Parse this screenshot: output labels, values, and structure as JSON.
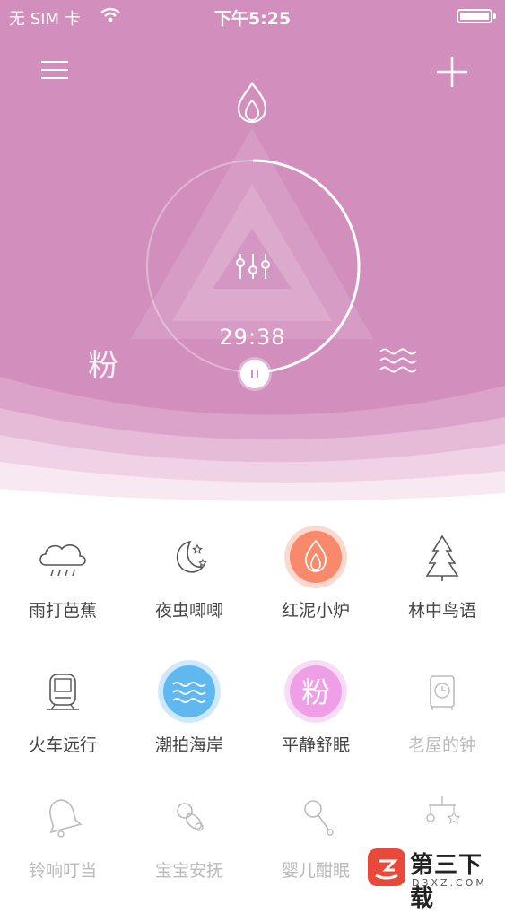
{
  "status_bar": {
    "carrier": "无 SIM 卡",
    "time": "下午5:25"
  },
  "player": {
    "timer": "29:38",
    "left_label": "粉",
    "current_scene": "红泥小炉"
  },
  "colors": {
    "hero_pink": "#d28fbd",
    "fire_orange": "#f8896b",
    "water_blue": "#5fb8ef",
    "pink_noise": "#ef9fe6"
  },
  "sounds": [
    {
      "label": "雨打芭蕉",
      "icon": "rain-cloud-icon",
      "active": false,
      "dim": false
    },
    {
      "label": "夜虫唧唧",
      "icon": "moon-stars-icon",
      "active": false,
      "dim": false
    },
    {
      "label": "红泥小炉",
      "icon": "flame-icon",
      "active": true,
      "dim": false
    },
    {
      "label": "林中鸟语",
      "icon": "pine-tree-icon",
      "active": false,
      "dim": false
    },
    {
      "label": "火车远行",
      "icon": "train-icon",
      "active": false,
      "dim": false
    },
    {
      "label": "潮拍海岸",
      "icon": "waves-icon",
      "active": true,
      "dim": false
    },
    {
      "label": "平静舒眠",
      "icon": "pink-noise-icon",
      "glyph": "粉",
      "active": true,
      "dim": false
    },
    {
      "label": "老屋的钟",
      "icon": "clock-icon",
      "active": false,
      "dim": true
    },
    {
      "label": "铃响叮当",
      "icon": "bell-icon",
      "active": false,
      "dim": true
    },
    {
      "label": "宝宝安抚",
      "icon": "pacifier-icon",
      "active": false,
      "dim": true
    },
    {
      "label": "婴儿酣眠",
      "icon": "rattle-icon",
      "active": false,
      "dim": true
    },
    {
      "label": "",
      "icon": "baby-mobile-icon",
      "active": false,
      "dim": true
    }
  ],
  "watermark": {
    "title": "第三下载",
    "subtitle": "D3XZ.COM"
  }
}
